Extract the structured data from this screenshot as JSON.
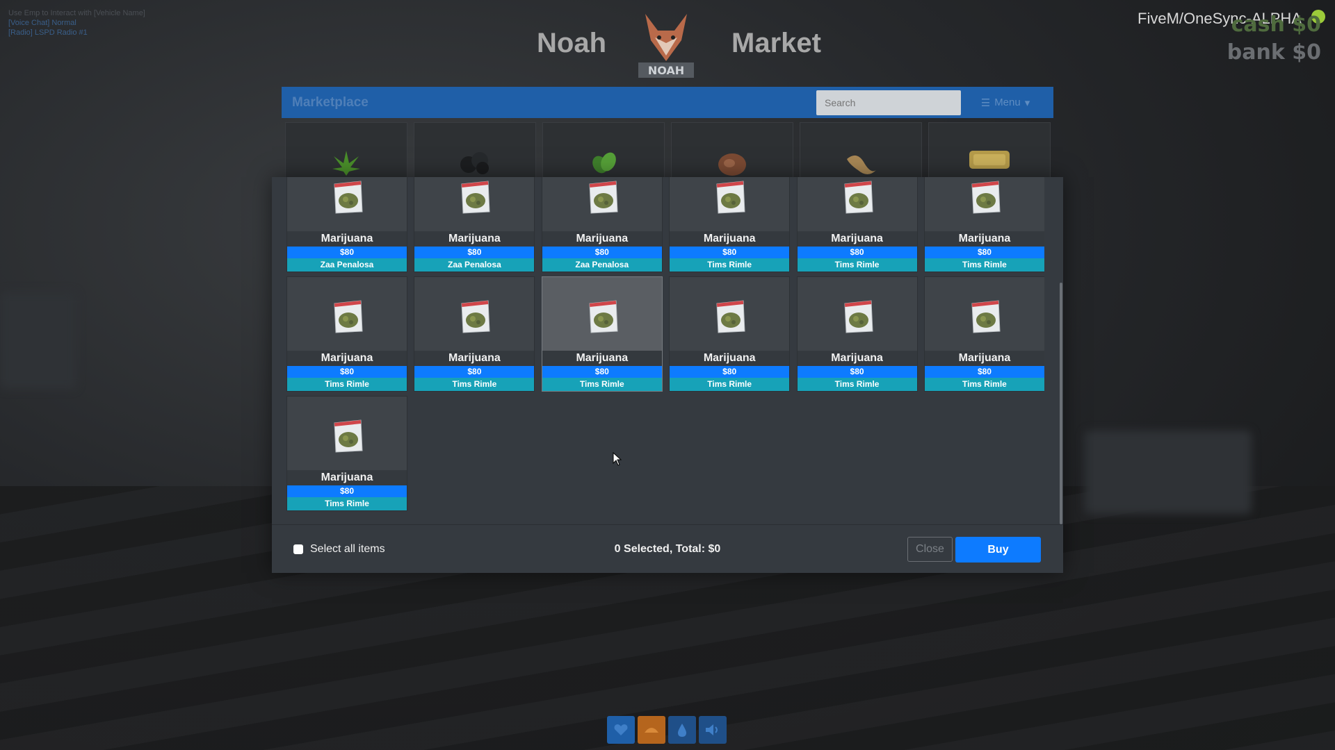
{
  "hud": {
    "line1": "Use Emp to Interact with [Vehicle Name]",
    "line2": "[Voice Chat] Normal",
    "line3": "[Radio] LSPD Radio #1",
    "server_name": "FiveM/OneSync-ALPHA",
    "cash": "cash $0",
    "bank": "bank $0"
  },
  "brand": {
    "left": "Noah",
    "right": "Market",
    "logo_text": "NOAH"
  },
  "topbar": {
    "title": "Marketplace",
    "search_placeholder": "Search",
    "menu_label": "Menu",
    "color": "#1f5fa8"
  },
  "categories": [
    {
      "icon": "cannabis-leaf-icon"
    },
    {
      "icon": "coal-rocks-icon"
    },
    {
      "icon": "herb-leaves-icon"
    },
    {
      "icon": "meat-icon"
    },
    {
      "icon": "bread-icon"
    },
    {
      "icon": "gold-bar-icon"
    }
  ],
  "items": [
    {
      "name": "Marijuana",
      "price": "$80",
      "seller": "Zaa Penalosa"
    },
    {
      "name": "Marijuana",
      "price": "$80",
      "seller": "Zaa Penalosa"
    },
    {
      "name": "Marijuana",
      "price": "$80",
      "seller": "Zaa Penalosa"
    },
    {
      "name": "Marijuana",
      "price": "$80",
      "seller": "Tims Rimle"
    },
    {
      "name": "Marijuana",
      "price": "$80",
      "seller": "Tims Rimle"
    },
    {
      "name": "Marijuana",
      "price": "$80",
      "seller": "Tims Rimle"
    },
    {
      "name": "Marijuana",
      "price": "$80",
      "seller": "Tims Rimle"
    },
    {
      "name": "Marijuana",
      "price": "$80",
      "seller": "Tims Rimle"
    },
    {
      "name": "Marijuana",
      "price": "$80",
      "seller": "Tims Rimle"
    },
    {
      "name": "Marijuana",
      "price": "$80",
      "seller": "Tims Rimle"
    },
    {
      "name": "Marijuana",
      "price": "$80",
      "seller": "Tims Rimle"
    },
    {
      "name": "Marijuana",
      "price": "$80",
      "seller": "Tims Rimle"
    },
    {
      "name": "Marijuana",
      "price": "$80",
      "seller": "Tims Rimle"
    }
  ],
  "highlighted_item_index": 8,
  "footer": {
    "select_all_label": "Select all items",
    "total_text": "0 Selected, Total: $0",
    "close_label": "Close",
    "buy_label": "Buy"
  },
  "colors": {
    "price_bar": "#0d7bff",
    "seller_bar": "#17a2b8",
    "buy_button": "#0d7bff"
  },
  "bottom_icons": [
    {
      "icon": "heart-icon",
      "color": "#1f5fa8"
    },
    {
      "icon": "shield-icon",
      "color": "#b5651d"
    },
    {
      "icon": "water-drop-icon",
      "color": "#1f4f88"
    },
    {
      "icon": "speaker-icon",
      "color": "#1f4f88"
    }
  ]
}
